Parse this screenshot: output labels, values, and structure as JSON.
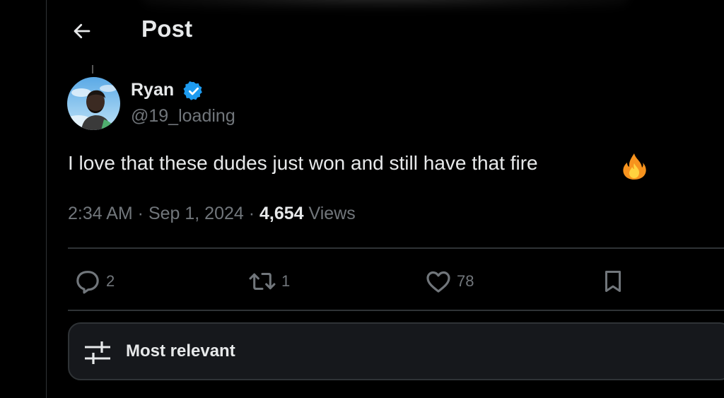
{
  "header": {
    "title": "Post",
    "back_icon": "arrow-left-icon"
  },
  "post": {
    "author": {
      "display_name": "Ryan",
      "handle": "@19_loading",
      "verified_icon": "verified-badge-icon",
      "verified_color": "#1d9bf0"
    },
    "text": "I love that these dudes just won and still have that fire",
    "emoji": "🔥",
    "time": "2:34 AM",
    "separator": " · ",
    "date": "Sep 1, 2024",
    "views_count": "4,654",
    "views_label": "Views"
  },
  "actions": {
    "replies": {
      "icon": "reply-icon",
      "count": "2"
    },
    "reposts": {
      "icon": "repost-icon",
      "count": "1"
    },
    "likes": {
      "icon": "heart-icon",
      "count": "78"
    },
    "bookmark": {
      "icon": "bookmark-icon"
    }
  },
  "replies_sort": {
    "icon": "sliders-icon",
    "label": "Most relevant"
  },
  "colors": {
    "background": "#000000",
    "text_primary": "#e7e9ea",
    "text_secondary": "#71767b",
    "border": "#2f3336",
    "accent": "#1d9bf0"
  }
}
